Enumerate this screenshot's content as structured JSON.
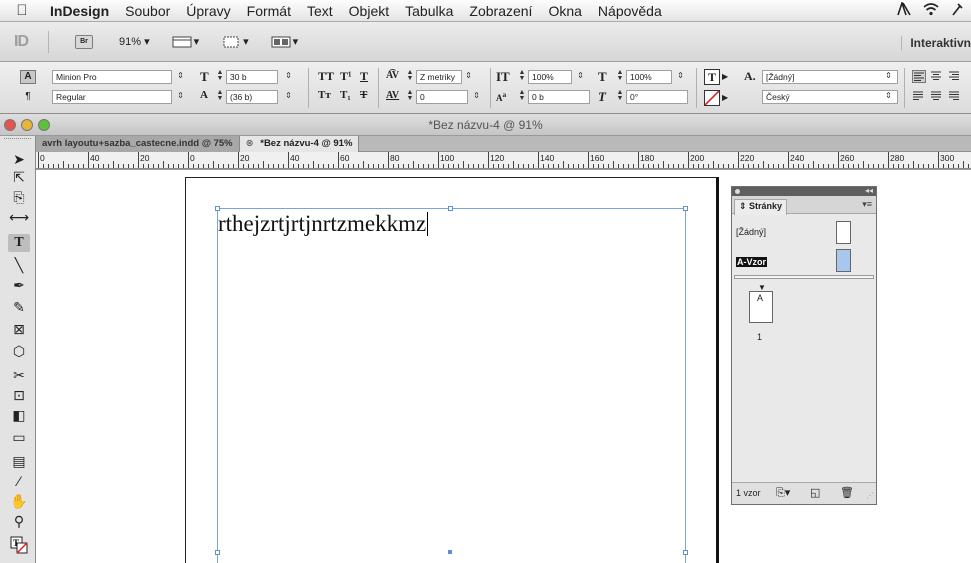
{
  "menubar": {
    "apple": "",
    "app_name": "InDesign",
    "items": [
      "Soubor",
      "Úpravy",
      "Formát",
      "Text",
      "Objekt",
      "Tabulka",
      "Zobrazení",
      "Okna",
      "Nápověda"
    ]
  },
  "appbar": {
    "app_icon": "ID",
    "bridge": "Br",
    "zoom": "91%",
    "workspace": "Interaktivn"
  },
  "control": {
    "font_family": "Minion Pro",
    "font_style": "Regular",
    "font_size": "30 b",
    "leading": "(36 b)",
    "kerning": "Z metriky",
    "tracking": "0",
    "vertical_scale": "100%",
    "horizontal_scale": "100%",
    "baseline_shift": "0 b",
    "skew": "0°",
    "char_style": "[Žádný]",
    "language": "Český"
  },
  "document": {
    "window_title": "*Bez názvu-4 @ 91%",
    "tabs": [
      {
        "label": "avrh layoutu+sazba_castecne.indd @ 75%"
      },
      {
        "label": "*Bez názvu-4 @ 91%"
      }
    ],
    "ruler_labels": [
      "0",
      "40",
      "20",
      "0",
      "20",
      "40",
      "60",
      "80",
      "100",
      "120",
      "140",
      "160",
      "180",
      "200",
      "220",
      "240",
      "260",
      "280",
      "300"
    ],
    "frame_text": "rthejzrtjrtjnrtzmekkmz"
  },
  "pages_panel": {
    "title": "Stránky",
    "none_master": "[Žádný]",
    "master": "A-Vzor",
    "page_label": "A",
    "page_number": "1",
    "footer": "1 vzor"
  }
}
